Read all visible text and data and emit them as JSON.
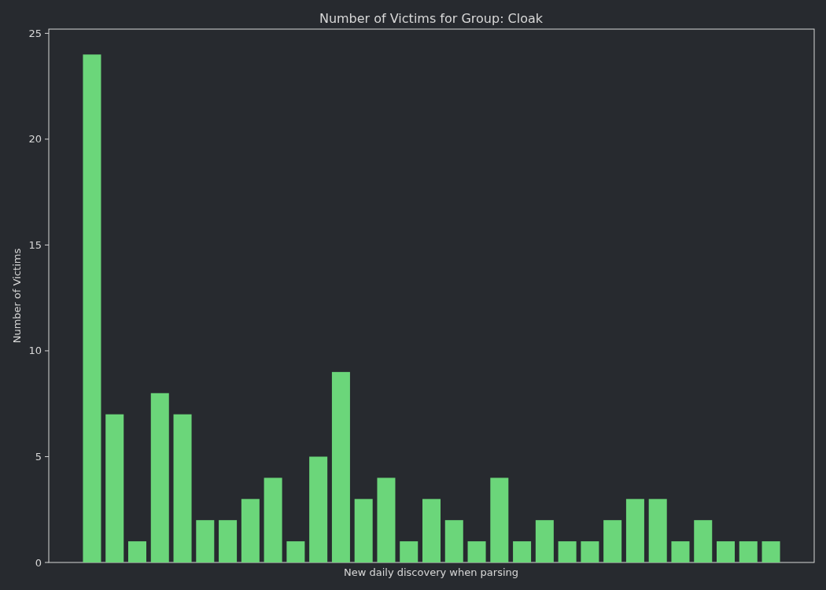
{
  "chart_data": {
    "type": "bar",
    "title": "Number of Victims for Group: Cloak",
    "xlabel": "New daily discovery when parsing",
    "ylabel": "Number of Victims",
    "categories": [
      null,
      null,
      null,
      null,
      null,
      null,
      null,
      null,
      null,
      null,
      null,
      null,
      null,
      null,
      null,
      null,
      null,
      null,
      null,
      null,
      null,
      null,
      null,
      null,
      null,
      null,
      null,
      null,
      null,
      null,
      null
    ],
    "series": [
      {
        "color": "#6bd67a",
        "values": [
          24,
          7,
          1,
          8,
          7,
          2,
          2,
          3,
          4,
          1,
          5,
          9,
          3,
          4,
          1,
          3,
          2,
          1,
          4,
          1,
          2,
          1,
          1,
          2,
          3,
          3,
          1,
          2,
          1,
          1,
          1
        ]
      }
    ],
    "ylim": [
      0,
      25.2
    ],
    "yticks": [
      0,
      5,
      10,
      15,
      20,
      25
    ]
  }
}
